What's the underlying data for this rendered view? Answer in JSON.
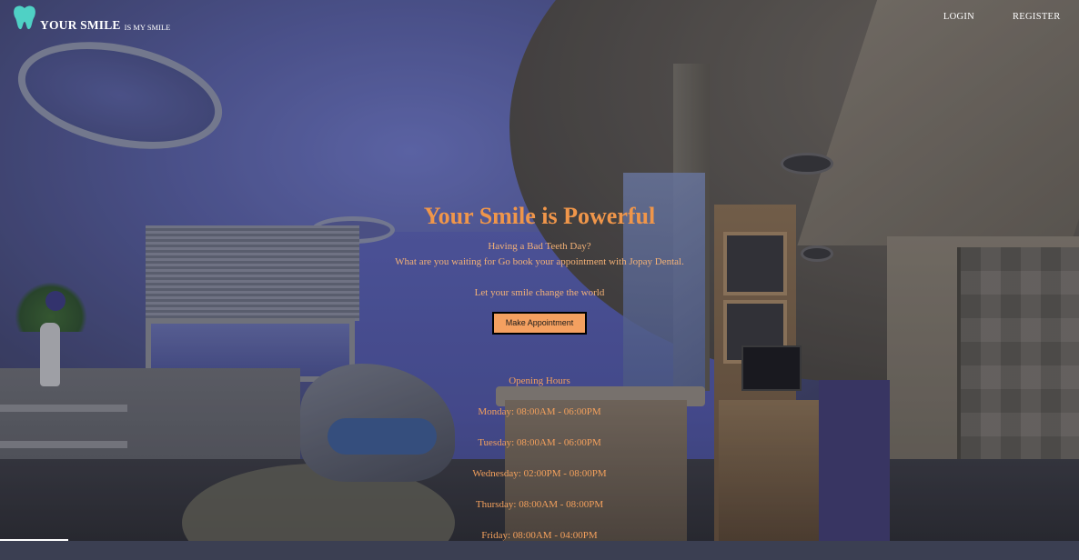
{
  "header": {
    "brand_name": "YOUR SMILE",
    "brand_tagline": "IS MY SMILE",
    "logo_icon": "tooth-icon",
    "nav": [
      {
        "label": "LOGIN"
      },
      {
        "label": "REGISTER"
      }
    ]
  },
  "hero": {
    "title": "Your Smile is Powerful",
    "line1": "Having a Bad Teeth Day?",
    "line2": "What are you waiting for  Go book your appointment with Jopay Dental.",
    "tagline": "Let your smile change the world",
    "cta_label": "Make Appointment"
  },
  "hours": {
    "title": "Opening Hours",
    "days": [
      "Monday: 08:00AM - 06:00PM",
      "Tuesday: 08:00AM - 06:00PM",
      "Wednesday: 02:00PM - 08:00PM",
      "Thursday: 08:00AM - 08:00PM",
      "Friday: 08:00AM - 04:00PM"
    ]
  },
  "colors": {
    "accent": "#f0964a",
    "button_bg": "#f4a060",
    "logo": "#4fd1c5"
  }
}
